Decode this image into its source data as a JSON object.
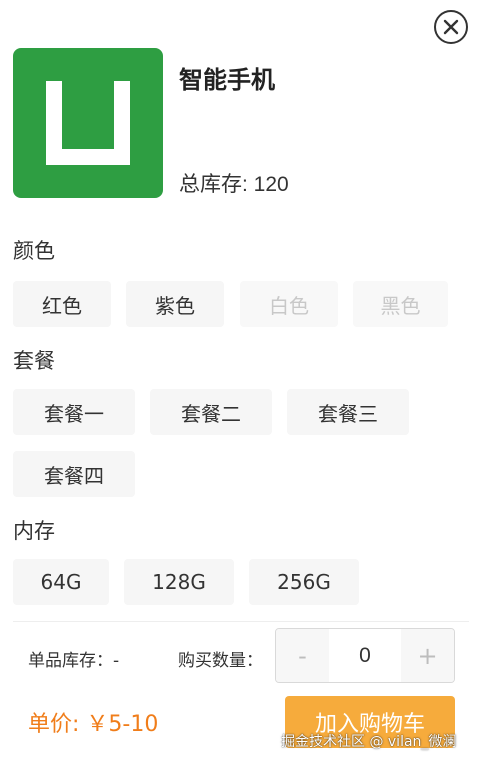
{
  "product": {
    "name": "智能手机",
    "total_stock_label": "总库存: 120",
    "image_color": "#2e9e42"
  },
  "groups": [
    {
      "title": "颜色",
      "options": [
        {
          "label": "红色",
          "disabled": false
        },
        {
          "label": "紫色",
          "disabled": false
        },
        {
          "label": "白色",
          "disabled": true
        },
        {
          "label": "黑色",
          "disabled": true
        }
      ]
    },
    {
      "title": "套餐",
      "options": [
        {
          "label": "套餐一",
          "disabled": false
        },
        {
          "label": "套餐二",
          "disabled": false
        },
        {
          "label": "套餐三",
          "disabled": false
        },
        {
          "label": "套餐四",
          "disabled": false
        }
      ]
    },
    {
      "title": "内存",
      "options": [
        {
          "label": "64G",
          "disabled": false
        },
        {
          "label": "128G",
          "disabled": false
        },
        {
          "label": "256G",
          "disabled": false
        }
      ]
    }
  ],
  "footer": {
    "item_stock_label": "单品库存：-",
    "quantity_label": "购买数量：",
    "decrement_label": "-",
    "increment_label": "+",
    "quantity_value": "0",
    "price_label": "单价: ￥5-10",
    "add_to_cart_label": "加入购物车"
  },
  "watermark": "掘金技术社区 @ vilan_微澜",
  "colors": {
    "accent": "#f07d1a",
    "button": "#f6ab3c",
    "option_bg": "#f6f6f6",
    "disabled_text": "#c8c8c8"
  }
}
